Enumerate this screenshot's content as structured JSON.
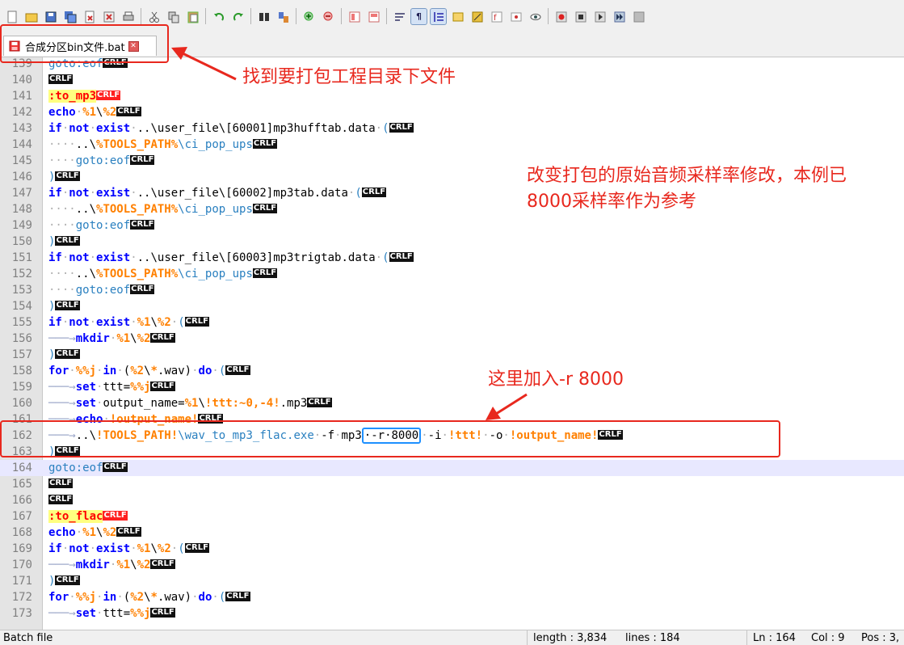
{
  "tab": {
    "label": "合成分区bin文件.bat"
  },
  "editor": {
    "lines": [
      {
        "n": "139",
        "parts": [
          [
            "gl",
            "goto:eof"
          ],
          [
            "crlf",
            "CRLF"
          ]
        ]
      },
      {
        "n": "140",
        "parts": [
          [
            "crlf",
            "CRLF"
          ]
        ]
      },
      {
        "n": "141",
        "parts": [
          [
            "lbl",
            ":to_mp3"
          ],
          [
            "crlfred",
            "CRLF"
          ]
        ]
      },
      {
        "n": "142",
        "parts": [
          [
            "kw",
            "echo"
          ],
          [
            "ws",
            "·"
          ],
          [
            "var",
            "%1"
          ],
          [
            "txt",
            "\\"
          ],
          [
            "var",
            "%2"
          ],
          [
            "crlf",
            "CRLF"
          ]
        ]
      },
      {
        "n": "143",
        "parts": [
          [
            "kw",
            "if"
          ],
          [
            "ws",
            "·"
          ],
          [
            "kw",
            "not"
          ],
          [
            "ws",
            "·"
          ],
          [
            "kw",
            "exist"
          ],
          [
            "ws",
            "·"
          ],
          [
            "txt",
            "..\\user_file\\[60001]mp3hufftab.data"
          ],
          [
            "ws",
            "·"
          ],
          [
            "gl",
            "("
          ],
          [
            "crlf",
            "CRLF"
          ]
        ]
      },
      {
        "n": "144",
        "parts": [
          [
            "ws",
            "····"
          ],
          [
            "txt",
            "..\\"
          ],
          [
            "var",
            "%TOOLS_PATH%"
          ],
          [
            "gl",
            "\\ci_pop_ups"
          ],
          [
            "crlf",
            "CRLF"
          ]
        ]
      },
      {
        "n": "145",
        "parts": [
          [
            "ws",
            "····"
          ],
          [
            "gl",
            "goto:eof"
          ],
          [
            "crlf",
            "CRLF"
          ]
        ]
      },
      {
        "n": "146",
        "parts": [
          [
            "gl",
            ")"
          ],
          [
            "crlf",
            "CRLF"
          ]
        ]
      },
      {
        "n": "147",
        "parts": [
          [
            "kw",
            "if"
          ],
          [
            "ws",
            "·"
          ],
          [
            "kw",
            "not"
          ],
          [
            "ws",
            "·"
          ],
          [
            "kw",
            "exist"
          ],
          [
            "ws",
            "·"
          ],
          [
            "txt",
            "..\\user_file\\[60002]mp3tab.data"
          ],
          [
            "ws",
            "·"
          ],
          [
            "gl",
            "("
          ],
          [
            "crlf",
            "CRLF"
          ]
        ]
      },
      {
        "n": "148",
        "parts": [
          [
            "ws",
            "····"
          ],
          [
            "txt",
            "..\\"
          ],
          [
            "var",
            "%TOOLS_PATH%"
          ],
          [
            "gl",
            "\\ci_pop_ups"
          ],
          [
            "crlf",
            "CRLF"
          ]
        ]
      },
      {
        "n": "149",
        "parts": [
          [
            "ws",
            "····"
          ],
          [
            "gl",
            "goto:eof"
          ],
          [
            "crlf",
            "CRLF"
          ]
        ]
      },
      {
        "n": "150",
        "parts": [
          [
            "gl",
            ")"
          ],
          [
            "crlf",
            "CRLF"
          ]
        ]
      },
      {
        "n": "151",
        "parts": [
          [
            "kw",
            "if"
          ],
          [
            "ws",
            "·"
          ],
          [
            "kw",
            "not"
          ],
          [
            "ws",
            "·"
          ],
          [
            "kw",
            "exist"
          ],
          [
            "ws",
            "·"
          ],
          [
            "txt",
            "..\\user_file\\[60003]mp3trigtab.data"
          ],
          [
            "ws",
            "·"
          ],
          [
            "gl",
            "("
          ],
          [
            "crlf",
            "CRLF"
          ]
        ]
      },
      {
        "n": "152",
        "parts": [
          [
            "ws",
            "····"
          ],
          [
            "txt",
            "..\\"
          ],
          [
            "var",
            "%TOOLS_PATH%"
          ],
          [
            "gl",
            "\\ci_pop_ups"
          ],
          [
            "crlf",
            "CRLF"
          ]
        ]
      },
      {
        "n": "153",
        "parts": [
          [
            "ws",
            "····"
          ],
          [
            "gl",
            "goto:eof"
          ],
          [
            "crlf",
            "CRLF"
          ]
        ]
      },
      {
        "n": "154",
        "parts": [
          [
            "gl",
            ")"
          ],
          [
            "crlf",
            "CRLF"
          ]
        ]
      },
      {
        "n": "155",
        "parts": [
          [
            "kw",
            "if"
          ],
          [
            "ws",
            "·"
          ],
          [
            "kw",
            "not"
          ],
          [
            "ws",
            "·"
          ],
          [
            "kw",
            "exist"
          ],
          [
            "ws",
            "·"
          ],
          [
            "var",
            "%1"
          ],
          [
            "txt",
            "\\"
          ],
          [
            "var",
            "%2"
          ],
          [
            "ws",
            "·"
          ],
          [
            "gl",
            "("
          ],
          [
            "crlf",
            "CRLF"
          ]
        ]
      },
      {
        "n": "156",
        "parts": [
          [
            "arr",
            "───→"
          ],
          [
            "kw",
            "mkdir"
          ],
          [
            "ws",
            "·"
          ],
          [
            "var",
            "%1"
          ],
          [
            "txt",
            "\\"
          ],
          [
            "var",
            "%2"
          ],
          [
            "crlf",
            "CRLF"
          ]
        ]
      },
      {
        "n": "157",
        "parts": [
          [
            "gl",
            ")"
          ],
          [
            "crlf",
            "CRLF"
          ]
        ]
      },
      {
        "n": "158",
        "parts": [
          [
            "kw",
            "for"
          ],
          [
            "ws",
            "·"
          ],
          [
            "var",
            "%%j"
          ],
          [
            "ws",
            "·"
          ],
          [
            "kw",
            "in"
          ],
          [
            "ws",
            "·"
          ],
          [
            "txt",
            "("
          ],
          [
            "var",
            "%2"
          ],
          [
            "txt",
            "\\"
          ],
          [
            "var",
            "*"
          ],
          [
            "txt",
            ".wav)"
          ],
          [
            "ws",
            "·"
          ],
          [
            "kw",
            "do"
          ],
          [
            "ws",
            "·"
          ],
          [
            "gl",
            "("
          ],
          [
            "crlf",
            "CRLF"
          ]
        ]
      },
      {
        "n": "159",
        "parts": [
          [
            "arr",
            "───→"
          ],
          [
            "kw",
            "set"
          ],
          [
            "ws",
            "·"
          ],
          [
            "txt",
            "ttt="
          ],
          [
            "var",
            "%%j"
          ],
          [
            "crlf",
            "CRLF"
          ]
        ]
      },
      {
        "n": "160",
        "parts": [
          [
            "arr",
            "───→"
          ],
          [
            "kw",
            "set"
          ],
          [
            "ws",
            "·"
          ],
          [
            "txt",
            "output_name="
          ],
          [
            "var",
            "%1"
          ],
          [
            "txt",
            "\\"
          ],
          [
            "var",
            "!ttt:~0,-4!"
          ],
          [
            "txt",
            ".mp3"
          ],
          [
            "crlf",
            "CRLF"
          ]
        ]
      },
      {
        "n": "161",
        "parts": [
          [
            "arr",
            "───→"
          ],
          [
            "kw",
            "echo"
          ],
          [
            "ws",
            "·"
          ],
          [
            "var",
            "!output_name!"
          ],
          [
            "crlf",
            "CRLF"
          ]
        ]
      },
      {
        "n": "162",
        "parts": [
          [
            "arr",
            "───→"
          ],
          [
            "txt",
            "..\\"
          ],
          [
            "var",
            "!TOOLS_PATH!"
          ],
          [
            "gl",
            "\\wav_to_mp3_flac.exe"
          ],
          [
            "ws",
            "·"
          ],
          [
            "txt",
            "-f"
          ],
          [
            "ws",
            "·"
          ],
          [
            "txt",
            "mp3"
          ],
          [
            "box",
            "·-r·8000"
          ],
          [
            "ws",
            "·"
          ],
          [
            "txt",
            "-i"
          ],
          [
            "ws",
            "·"
          ],
          [
            "var",
            "!ttt!"
          ],
          [
            "ws",
            "·"
          ],
          [
            "txt",
            "-o"
          ],
          [
            "ws",
            "·"
          ],
          [
            "var",
            "!output_name!"
          ],
          [
            "crlf",
            "CRLF"
          ]
        ]
      },
      {
        "n": "163",
        "parts": [
          [
            "gl",
            ")"
          ],
          [
            "crlf",
            "CRLF"
          ]
        ]
      },
      {
        "n": "164",
        "parts": [
          [
            "gl",
            "goto:eof"
          ],
          [
            "crlf",
            "CRLF"
          ]
        ],
        "cur": true
      },
      {
        "n": "165",
        "parts": [
          [
            "crlf",
            "CRLF"
          ]
        ]
      },
      {
        "n": "166",
        "parts": [
          [
            "crlf",
            "CRLF"
          ]
        ]
      },
      {
        "n": "167",
        "parts": [
          [
            "lbl",
            ":to_flac"
          ],
          [
            "crlfred",
            "CRLF"
          ]
        ]
      },
      {
        "n": "168",
        "parts": [
          [
            "kw",
            "echo"
          ],
          [
            "ws",
            "·"
          ],
          [
            "var",
            "%1"
          ],
          [
            "txt",
            "\\"
          ],
          [
            "var",
            "%2"
          ],
          [
            "crlf",
            "CRLF"
          ]
        ]
      },
      {
        "n": "169",
        "parts": [
          [
            "kw",
            "if"
          ],
          [
            "ws",
            "·"
          ],
          [
            "kw",
            "not"
          ],
          [
            "ws",
            "·"
          ],
          [
            "kw",
            "exist"
          ],
          [
            "ws",
            "·"
          ],
          [
            "var",
            "%1"
          ],
          [
            "txt",
            "\\"
          ],
          [
            "var",
            "%2"
          ],
          [
            "ws",
            "·"
          ],
          [
            "gl",
            "("
          ],
          [
            "crlf",
            "CRLF"
          ]
        ]
      },
      {
        "n": "170",
        "parts": [
          [
            "arr",
            "───→"
          ],
          [
            "kw",
            "mkdir"
          ],
          [
            "ws",
            "·"
          ],
          [
            "var",
            "%1"
          ],
          [
            "txt",
            "\\"
          ],
          [
            "var",
            "%2"
          ],
          [
            "crlf",
            "CRLF"
          ]
        ]
      },
      {
        "n": "171",
        "parts": [
          [
            "gl",
            ")"
          ],
          [
            "crlf",
            "CRLF"
          ]
        ]
      },
      {
        "n": "172",
        "parts": [
          [
            "kw",
            "for"
          ],
          [
            "ws",
            "·"
          ],
          [
            "var",
            "%%j"
          ],
          [
            "ws",
            "·"
          ],
          [
            "kw",
            "in"
          ],
          [
            "ws",
            "·"
          ],
          [
            "txt",
            "("
          ],
          [
            "var",
            "%2"
          ],
          [
            "txt",
            "\\"
          ],
          [
            "var",
            "*"
          ],
          [
            "txt",
            ".wav)"
          ],
          [
            "ws",
            "·"
          ],
          [
            "kw",
            "do"
          ],
          [
            "ws",
            "·"
          ],
          [
            "gl",
            "("
          ],
          [
            "crlf",
            "CRLF"
          ]
        ]
      },
      {
        "n": "173",
        "parts": [
          [
            "arr",
            "───→"
          ],
          [
            "kw",
            "set"
          ],
          [
            "ws",
            "·"
          ],
          [
            "txt",
            "ttt="
          ],
          [
            "var",
            "%%j"
          ],
          [
            "crlf",
            "CRLF"
          ]
        ]
      }
    ]
  },
  "annotations": {
    "note1": "找到要打包工程目录下文件",
    "note2_line1": "改变打包的原始音频采样率修改，本例已",
    "note2_line2": "8000采样率作为参考",
    "note3": "这里加入-r 8000"
  },
  "status": {
    "file_type": "Batch file",
    "length": "length : 3,834",
    "lines": "lines : 184",
    "ln": "Ln : 164",
    "col": "Col : 9",
    "pos": "Pos : 3,"
  },
  "colors": {
    "annotation_red": "#e8281e",
    "keyword_blue": "#0000ff",
    "variable_orange": "#ff8000",
    "highlight_box": "#1e90ff"
  }
}
